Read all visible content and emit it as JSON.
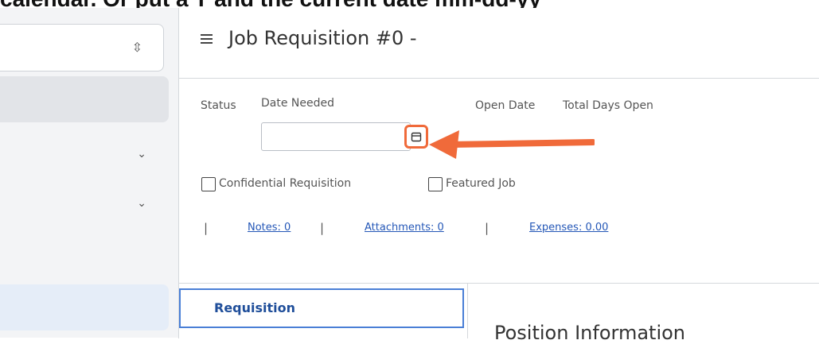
{
  "caption": "calendar. Or put a T and the current date mm-dd-yy",
  "header": {
    "title": "Job Requisition #0 -"
  },
  "fields": {
    "status_label": "Status",
    "date_needed_label": "Date Needed",
    "date_needed_value": "",
    "open_date_label": "Open Date",
    "total_days_label": "Total Days Open"
  },
  "checkboxes": {
    "confidential": {
      "label": "Confidential Requisition",
      "checked": false
    },
    "featured": {
      "label": "Featured Job",
      "checked": false
    }
  },
  "links": {
    "notes": "Notes: 0",
    "attachments": "Attachments: 0",
    "expenses": "Expenses: 0.00"
  },
  "tabs": {
    "requisition": "Requisition"
  },
  "section": {
    "heading": "Position Information"
  },
  "colors": {
    "highlight": "#f06a3a",
    "link": "#2457b7",
    "tab_border": "#4a7fd6"
  }
}
